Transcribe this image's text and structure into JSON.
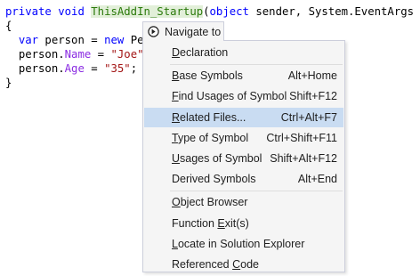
{
  "code": {
    "line1": {
      "kw_private": "private",
      "kw_void": "void",
      "method_name": "ThisAddIn_Startup",
      "paren_open": "(",
      "kw_object": "object",
      "rest": " sender, System.EventArgs e)"
    },
    "line2": "{",
    "line3": {
      "kw_var": "var",
      "text1": " person = ",
      "kw_new": "new",
      "text2": " Per"
    },
    "line4": {
      "obj": "person.",
      "prop": "Name",
      "eq": " = ",
      "str": "\"Joe\"",
      "semi": ";"
    },
    "line5": {
      "obj": "person.",
      "prop": "Age",
      "eq": " = ",
      "str": "\"35\"",
      "semi": ";"
    },
    "line6": "}"
  },
  "popup": {
    "header_title": "Navigate to",
    "header_icon": "navigate-icon",
    "groups": [
      [
        {
          "pre": "",
          "key": "D",
          "post": "eclaration",
          "shortcut": ""
        }
      ],
      [
        {
          "pre": "",
          "key": "B",
          "post": "ase Symbols",
          "shortcut": "Alt+Home"
        },
        {
          "pre": "",
          "key": "F",
          "post": "ind Usages of Symbol",
          "shortcut": "Shift+F12"
        },
        {
          "pre": "",
          "key": "R",
          "post": "elated Files...",
          "shortcut": "Ctrl+Alt+F7",
          "selected": true
        },
        {
          "pre": "",
          "key": "T",
          "post": "ype of Symbol",
          "shortcut": "Ctrl+Shift+F11"
        },
        {
          "pre": "",
          "key": "U",
          "post": "sages of Symbol",
          "shortcut": "Shift+Alt+F12"
        },
        {
          "pre": "Derived Symbols",
          "key": "",
          "post": "",
          "shortcut": "Alt+End"
        }
      ],
      [
        {
          "pre": "",
          "key": "O",
          "post": "bject Browser",
          "shortcut": ""
        },
        {
          "pre": "Function ",
          "key": "E",
          "post": "xit(s)",
          "shortcut": ""
        },
        {
          "pre": "",
          "key": "L",
          "post": "ocate in Solution Explorer",
          "shortcut": ""
        },
        {
          "pre": "Referenced ",
          "key": "C",
          "post": "ode",
          "shortcut": ""
        }
      ]
    ]
  },
  "colors": {
    "keyword": "#0000ff",
    "highlight_text": "#2b7a0b",
    "highlight_bg": "#e2efd9",
    "property": "#8a2be2",
    "string": "#a31515",
    "menu_bg": "#f5f5f5",
    "menu_selected": "#c9dcf2"
  }
}
